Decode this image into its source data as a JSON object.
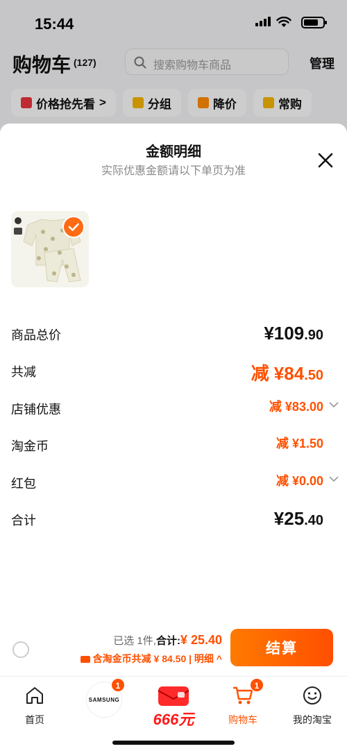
{
  "status_bar": {
    "time": "15:44"
  },
  "cart": {
    "title": "购物车",
    "count": "(127)",
    "search_placeholder": "搜索购物车商品",
    "manage_label": "管理",
    "chips": [
      {
        "label": "价格抢先看",
        "icon": "bookmark-icon",
        "suffix": ">"
      },
      {
        "label": "分组",
        "icon": "folder-icon"
      },
      {
        "label": "降价",
        "icon": "price-down-icon"
      },
      {
        "label": "常购",
        "icon": "cart-icon"
      }
    ]
  },
  "sheet": {
    "title": "金额明细",
    "subtitle": "实际优惠金额请以下单页为准",
    "rows": {
      "goods_total": {
        "label": "商品总价",
        "prefix": "",
        "int": "¥109",
        "dec": ".90"
      },
      "total_discount": {
        "label": "共减",
        "prefix": "减 ",
        "int": "¥84",
        "dec": ".50"
      },
      "shop_discount": {
        "label": "店铺优惠",
        "prefix": "减 ",
        "int": "¥83",
        "dec": ".00"
      },
      "taojinbi": {
        "label": "淘金币",
        "prefix": "减 ",
        "int": "¥1",
        "dec": ".50"
      },
      "red_packet": {
        "label": "红包",
        "prefix": "减 ",
        "int": "¥0",
        "dec": ".00"
      },
      "total": {
        "label": "合计",
        "prefix": "",
        "int": "¥25",
        "dec": ".40"
      }
    }
  },
  "bottom": {
    "selected_text": "已选 1件,",
    "total_label": "合计:",
    "total_amount": "¥ 25.40",
    "coin_text": "含淘金币共减 ¥ 84.50 | 明细 ^",
    "pay_label": "结算"
  },
  "tabbar": {
    "items": [
      {
        "label": "首页"
      },
      {
        "label": "",
        "badge": "1",
        "logo": "SAMSUNG"
      },
      {
        "label": "",
        "promo": "666元"
      },
      {
        "label": "购物车",
        "badge": "1"
      },
      {
        "label": "我的淘宝"
      }
    ]
  },
  "colors": {
    "accent": "#ff5000"
  }
}
